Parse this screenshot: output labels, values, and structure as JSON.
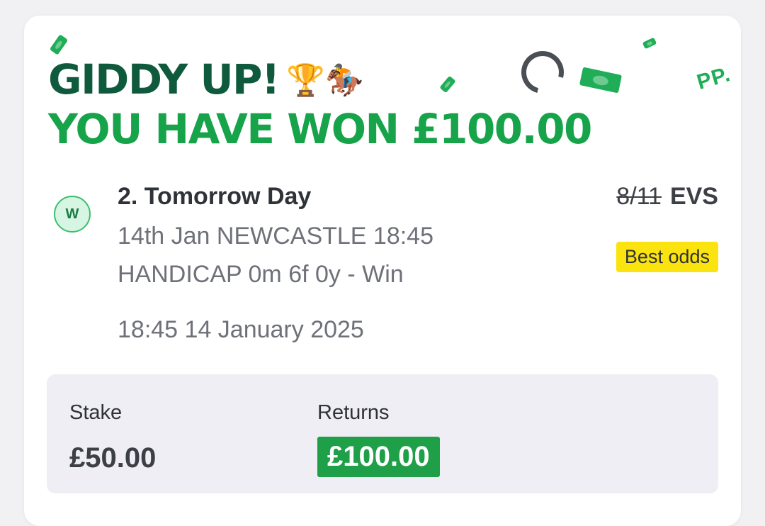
{
  "win_banner": {
    "line1": "GIDDY UP!",
    "line1_emoji": "🏆🏇",
    "line2": "YOU HAVE WON £100.00",
    "decor_text": "PP."
  },
  "selection": {
    "result_badge": "W",
    "name": "2. Tomorrow Day",
    "event": "14th Jan NEWCASTLE 18:45",
    "market": "HANDICAP 0m 6f 0y - Win",
    "datetime": "18:45 14 January 2025",
    "old_odds": "8/11",
    "new_odds": "EVS",
    "odds_badge": "Best odds"
  },
  "bet": {
    "stake_label": "Stake",
    "stake_value": "£50.00",
    "returns_label": "Returns",
    "returns_value": "£100.00"
  },
  "colors": {
    "dark_green": "#0f5a3c",
    "brand_green": "#16a34a",
    "best_odds_yellow": "#fbe30f",
    "returns_green": "#1fa048"
  }
}
